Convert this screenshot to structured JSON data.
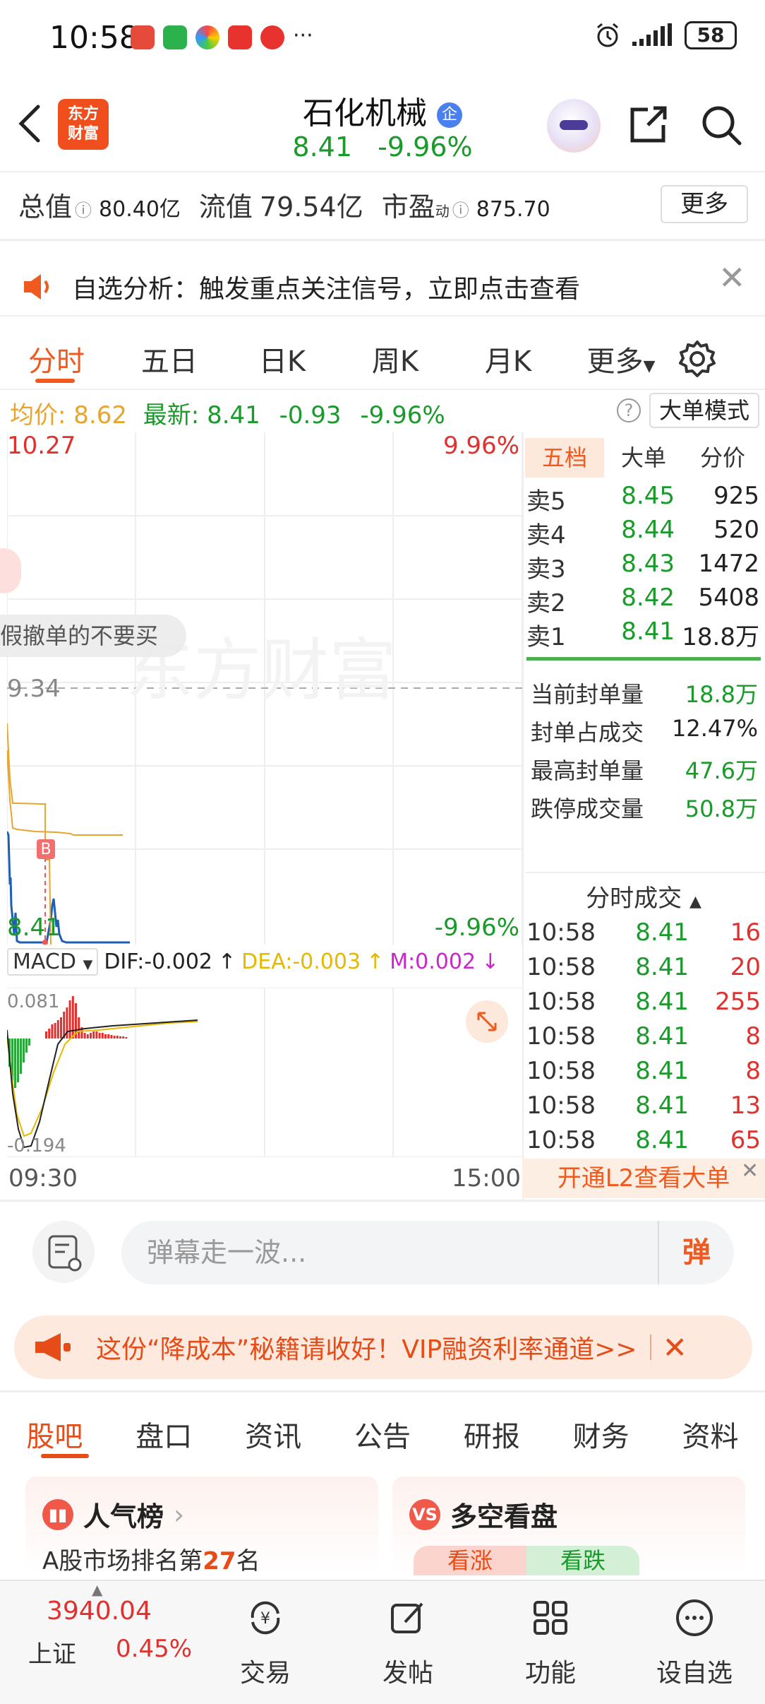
{
  "status_bar": {
    "time": "10:58",
    "battery": "58"
  },
  "header": {
    "stock_name": "石化机械",
    "badge": "企",
    "price": "8.41",
    "change_pct": "-9.96%",
    "logo_line1": "东方",
    "logo_line2": "财富"
  },
  "metrics": {
    "total_label": "总值",
    "total_value": "80.40亿",
    "float_label": "流值",
    "float_value": "79.54亿",
    "pe_label": "市盈",
    "pe_sup": "动",
    "pe_value": "875.70",
    "more_button": "更多"
  },
  "notice": {
    "text": "自选分析：触发重点关注信号，立即点击查看"
  },
  "chart_tabs": [
    "分时",
    "五日",
    "日K",
    "周K",
    "月K",
    "更多"
  ],
  "quote_line": {
    "avg_label": "均价:",
    "avg_value": "8.62",
    "latest_label": "最新:",
    "latest_value": "8.41",
    "change": "-0.93",
    "change_pct": "-9.96%",
    "mode_button": "大单模式"
  },
  "chart": {
    "top_price": "10.27",
    "top_pct": "9.96%",
    "mid_price": "9.34",
    "bottom_price": "8.41",
    "bottom_pct": "-9.96%",
    "marker": "B",
    "overlay_bubble": "假撤单的不要买",
    "watermark": "东方财富",
    "time_start": "09:30",
    "time_end": "15:00"
  },
  "macd": {
    "label": "MACD",
    "dif": "DIF:-0.002",
    "dea": "DEA:-0.003",
    "m": "M:0.002",
    "top_value": "0.081",
    "bottom_value": "-0.194"
  },
  "right_tabs": [
    "五档",
    "大单",
    "分价"
  ],
  "order_book": [
    {
      "label": "卖5",
      "price": "8.45",
      "volume": "925"
    },
    {
      "label": "卖4",
      "price": "8.44",
      "volume": "520"
    },
    {
      "label": "卖3",
      "price": "8.43",
      "volume": "1472"
    },
    {
      "label": "卖2",
      "price": "8.42",
      "volume": "5408"
    },
    {
      "label": "卖1",
      "price": "8.41",
      "volume": "18.8万"
    }
  ],
  "seal_info": [
    {
      "label": "当前封单量",
      "value": "18.8万"
    },
    {
      "label": "封单占成交",
      "value": "12.47%"
    },
    {
      "label": "最高封单量",
      "value": "47.6万"
    },
    {
      "label": "跌停成交量",
      "value": "50.8万"
    }
  ],
  "ticks_header": "分时成交",
  "ticks": [
    {
      "time": "10:58",
      "price": "8.41",
      "volume": "16"
    },
    {
      "time": "10:58",
      "price": "8.41",
      "volume": "20"
    },
    {
      "time": "10:58",
      "price": "8.41",
      "volume": "255"
    },
    {
      "time": "10:58",
      "price": "8.41",
      "volume": "8"
    },
    {
      "time": "10:58",
      "price": "8.41",
      "volume": "8"
    },
    {
      "time": "10:58",
      "price": "8.41",
      "volume": "13"
    },
    {
      "time": "10:58",
      "price": "8.41",
      "volume": "65"
    }
  ],
  "l2_banner": "开通L2查看大单",
  "comment": {
    "placeholder": "弹幕走一波...",
    "button": "弹"
  },
  "promo": {
    "text": "这份“降成本”秘籍请收好！VIP融资利率通道>>"
  },
  "bottom_tabs": [
    "股吧",
    "盘口",
    "资讯",
    "公告",
    "研报",
    "财务",
    "资料"
  ],
  "cards": {
    "left_title": "人气榜",
    "left_sub_prefix": "A股市场排名第",
    "left_rank": "27",
    "left_sub_suffix": "名",
    "right_title": "多空看盘",
    "bull": "看涨",
    "bear": "看跌"
  },
  "bottom_nav": {
    "index_value": "3940.04",
    "index_name": "上证",
    "index_change": "0.45%",
    "items": [
      "交易",
      "发帖",
      "功能",
      "设自选"
    ]
  },
  "colors": {
    "accent": "#f05a1e",
    "up": "#e0312f",
    "down": "#1a9a2a",
    "avg": "#e7a52e"
  }
}
